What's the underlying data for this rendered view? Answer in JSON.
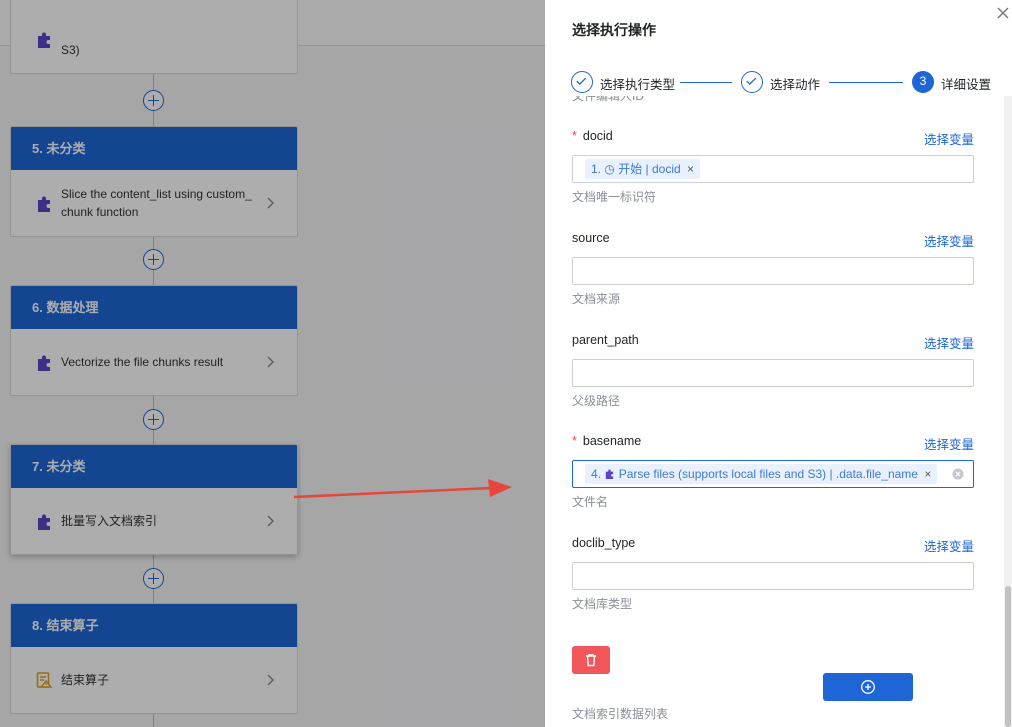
{
  "canvas": {
    "top_partial_text": "S3)",
    "nodes": [
      {
        "header": "5. 未分类",
        "body": "Slice the content_list using custom_ chunk function",
        "icon": "puzzle-icon"
      },
      {
        "header": "6. 数据处理",
        "body": "Vectorize the file chunks result",
        "icon": "puzzle-icon"
      },
      {
        "header": "7. 未分类",
        "body": "批量写入文档索引",
        "icon": "puzzle-icon"
      },
      {
        "header": "8. 结束算子",
        "body": "结束算子",
        "icon": "end-operator-icon"
      }
    ]
  },
  "drawer": {
    "title": "选择执行操作",
    "steps": [
      {
        "label": "选择执行类型",
        "state": "done"
      },
      {
        "label": "选择动作",
        "state": "done"
      },
      {
        "number": "3",
        "label": "详细设置",
        "state": "active"
      }
    ],
    "cut_off_text": "文件编辑人ID",
    "select_var_label": "选择变量",
    "fields": [
      {
        "name": "docid",
        "required": true,
        "tag": {
          "prefix": "1.",
          "text": "开始 | docid"
        },
        "hint": "文档唯一标识符"
      },
      {
        "name": "source",
        "required": false,
        "hint": "文档来源"
      },
      {
        "name": "parent_path",
        "required": false,
        "hint": "父级路径"
      },
      {
        "name": "basename",
        "required": true,
        "tag": {
          "prefix": "4.",
          "text": "Parse files (supports local files and S3) | .data.file_name"
        },
        "hint": "文件名"
      },
      {
        "name": "doclib_type",
        "required": false,
        "hint": "文档库类型"
      }
    ],
    "list_label": "文档索引数据列表"
  },
  "colors": {
    "primary": "#1e66d6",
    "danger": "#f0565a",
    "required": "#e5484d",
    "annotation_arrow": "#e8453c"
  }
}
